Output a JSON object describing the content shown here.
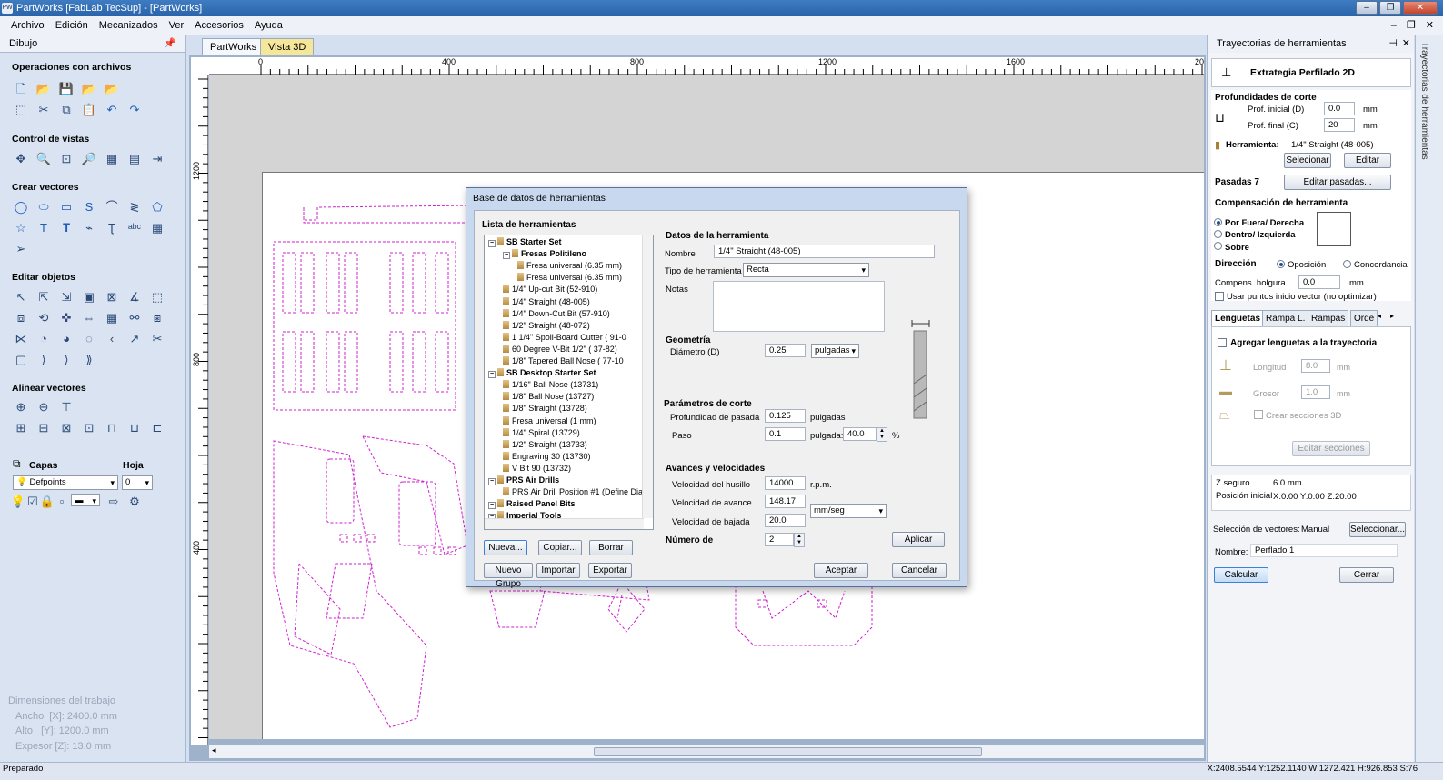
{
  "window": {
    "title": "PartWorks [FabLab TecSup] - [PartWorks]",
    "app_icon": "PW"
  },
  "menu": [
    "Archivo",
    "Edición",
    "Mecanizados",
    "Ver",
    "Accesorios",
    "Ayuda"
  ],
  "left": {
    "header": "Dibujo",
    "sections": {
      "file_ops": "Operaciones con archivos",
      "view_ctrl": "Control de vistas",
      "create_vectors": "Crear vectores",
      "edit_objects": "Editar objetos",
      "align_vectors": "Alinear vectores"
    },
    "layers": {
      "label": "Capas",
      "sheet_label": "Hoja",
      "layer_value": "Defpoints",
      "sheet_value": "0"
    },
    "job": {
      "title": "Dimensiones del trabajo",
      "width": "Ancho  [X]: 2400.0 mm",
      "height": "Alto   [Y]: 1200.0 mm",
      "thickness": "Expesor [Z]: 13.0 mm"
    }
  },
  "tabs": [
    "PartWorks",
    "Vista 3D"
  ],
  "ruler": {
    "h": [
      "0",
      "400",
      "800",
      "1200",
      "1600",
      "20"
    ],
    "v": [
      "1200",
      "800",
      "400"
    ]
  },
  "right": {
    "header": "Trayectorias de herramientas",
    "strategy": "Extrategia Perfilado 2D",
    "depths": {
      "title": "Profundidades de corte",
      "start_label": "Prof. inicial (D)",
      "start": "0.0",
      "end_label": "Prof. final (C)",
      "end": "20",
      "unit": "mm"
    },
    "tool": {
      "label": "Herramienta:",
      "value": "1/4\" Straight (48-005)",
      "select": "Selecionar",
      "edit": "Editar"
    },
    "passes": {
      "label": "Pasadas 7",
      "button": "Editar pasadas..."
    },
    "comp": {
      "title": "Compensación de herramienta",
      "opt1": "Por Fuera/ Derecha",
      "opt2": "Dentro/ Izquierda",
      "opt3": "Sobre"
    },
    "direction": {
      "label": "Dirección",
      "opt1": "Oposición",
      "opt2": "Concordancia"
    },
    "allowance": {
      "label": "Compens. holgura",
      "value": "0.0",
      "unit": "mm"
    },
    "use_start": "Usar puntos inicio vector (no optimizar)",
    "subtabs": [
      "Lenguetas",
      "Rampa L.",
      "Rampas",
      "Orde"
    ],
    "tabs_panel": {
      "add": "Agregar lenguetas a la trayectoria",
      "length_label": "Longitud",
      "length": "8.0",
      "thick_label": "Grosor",
      "thick": "1.0",
      "unit": "mm",
      "three_d": "Crear secciones 3D",
      "edit": "Editar secciones"
    },
    "safe": {
      "z_label": "Z seguro",
      "z": "6.0 mm",
      "home_label": "Posición inicial",
      "home": "X:0.00 Y:0.00 Z:20.00"
    },
    "selection": {
      "label": "Selección de vectores:",
      "value": "Manual",
      "button": "Seleccionar..."
    },
    "name": {
      "label": "Nombre:",
      "value": "Perflado 1"
    },
    "calc": "Calcular",
    "close": "Cerrar"
  },
  "side_strip": "Trayectorias de herramientas",
  "status": {
    "left": "Preparado",
    "coords": "X:2408.5544 Y:1252.1140   W:1272.421   H:926.853  S:76"
  },
  "dialog": {
    "title": "Base de datos de herramientas",
    "list_label": "Lista de herramientas",
    "tree": [
      {
        "t": "SB Starter Set",
        "g": true,
        "lvl": 0
      },
      {
        "t": "Fresas Politileno",
        "g": true,
        "lvl": 1
      },
      {
        "t": "Fresa universal (6.35 mm)",
        "lvl": 2
      },
      {
        "t": "Fresa universal (6.35 mm)",
        "lvl": 2
      },
      {
        "t": "1/4\" Up-cut Bit (52-910)",
        "lvl": 1
      },
      {
        "t": "1/4\" Straight  (48-005)",
        "lvl": 1
      },
      {
        "t": "1/4\"  Down-Cut Bit (57-910)",
        "lvl": 1
      },
      {
        "t": "1/2\" Straight  (48-072)",
        "lvl": 1
      },
      {
        "t": "1 1/4\" Spoil-Board Cutter  ( 91-0",
        "lvl": 1
      },
      {
        "t": "60 Degree V-Bit 1/2\"  ( 37-82)",
        "lvl": 1
      },
      {
        "t": "1/8\" Tapered Ball Nose  ( 77-10",
        "lvl": 1
      },
      {
        "t": "SB Desktop Starter Set",
        "g": true,
        "lvl": 0
      },
      {
        "t": "1/16\" Ball Nose (13731)",
        "lvl": 1
      },
      {
        "t": "1/8\" Ball Nose (13727)",
        "lvl": 1
      },
      {
        "t": "1/8\" Straight (13728)",
        "lvl": 1
      },
      {
        "t": "Fresa universal (1 mm)",
        "lvl": 1
      },
      {
        "t": "1/4\" Spiral (13729)",
        "lvl": 1
      },
      {
        "t": "1/2\" Straight (13733)",
        "lvl": 1
      },
      {
        "t": "Engraving 30 (13730)",
        "lvl": 1
      },
      {
        "t": "V Bit 90 (13732)",
        "lvl": 1
      },
      {
        "t": "PRS Air Drills",
        "g": true,
        "lvl": 0
      },
      {
        "t": "PRS Air Drill Position #1 (Define Dia",
        "lvl": 1
      },
      {
        "t": "Raised Panel Bits",
        "g": true,
        "lvl": 0
      },
      {
        "t": "Imperial Tools",
        "g": true,
        "lvl": 0
      }
    ],
    "buttons": {
      "new": "Nueva...",
      "copy": "Copiar...",
      "delete": "Borrar",
      "new_group": "Nuevo Grupo",
      "import": "Importar",
      "export": "Exportar",
      "apply": "Aplicar",
      "ok": "Aceptar",
      "cancel": "Cancelar"
    },
    "data": {
      "title": "Datos de la herramienta",
      "name_label": "Nombre",
      "name": "1/4\" Straight  (48-005)",
      "type_label": "Tipo de herramienta",
      "type": "Recta",
      "notes_label": "Notas",
      "geom": "Geometría",
      "diam_label": "Diámetro (D)",
      "diam": "0.25",
      "diam_unit": "pulgadas",
      "cut_title": "Parámetros de corte",
      "depth_label": "Profundidad de pasada",
      "depth": "0.125",
      "depth_unit": "pulgadas",
      "step_label": "Paso",
      "step": "0.1",
      "step_unit": "pulgada:",
      "step_pct": "40.0",
      "pct": "%",
      "feeds_title": "Avances y velocidades",
      "spindle_label": "Velocidad del husillo",
      "spindle": "14000",
      "rpm": "r.p.m.",
      "feed_label": "Velocidad de avance",
      "feed": "148.17",
      "feed_unit": "mm/seg",
      "plunge_label": "Velocidad de bajada",
      "plunge": "20.0",
      "num_label": "Número de",
      "num": "2"
    }
  }
}
